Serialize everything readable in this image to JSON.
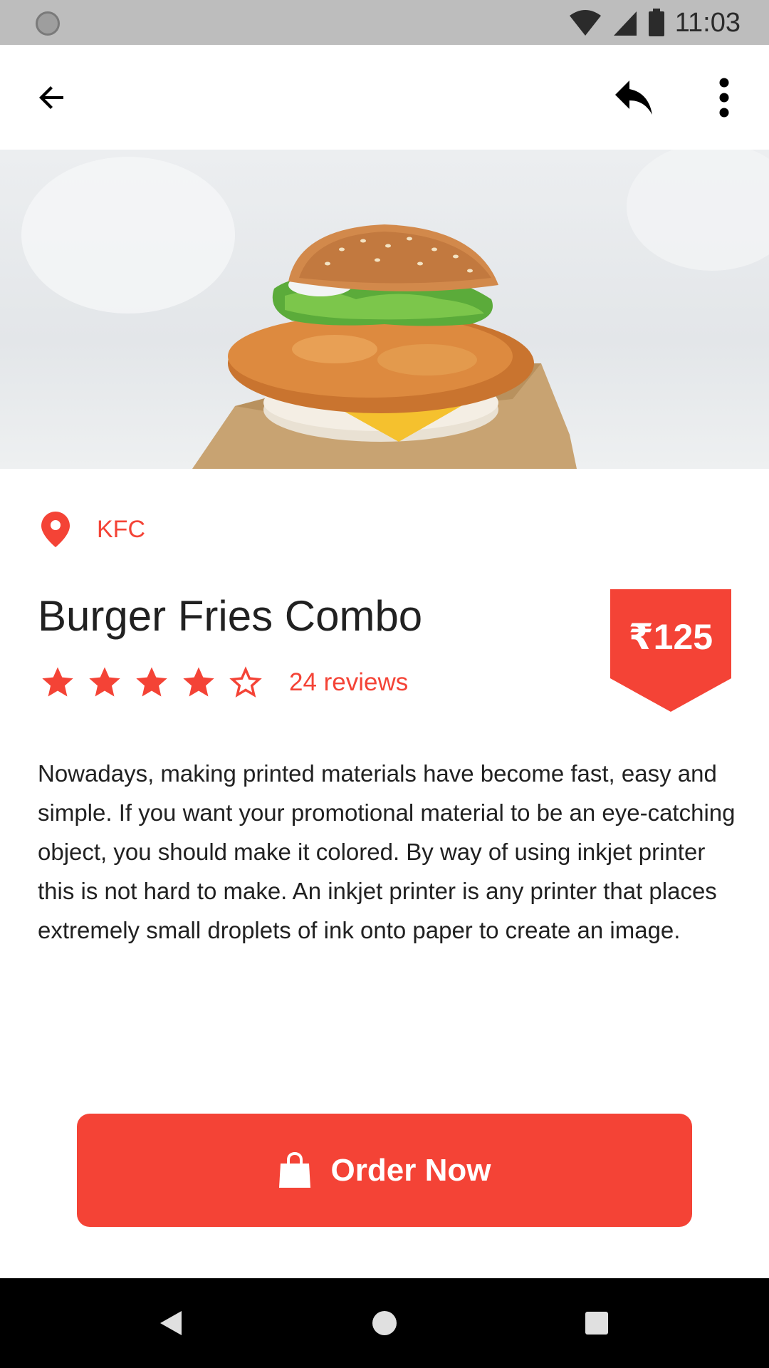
{
  "status_bar": {
    "time": "11:03",
    "icons": [
      "notification-dot-icon",
      "wifi-icon",
      "signal-icon",
      "battery-icon"
    ]
  },
  "app_bar": {
    "icons": [
      "back-arrow-icon",
      "share-reply-icon",
      "more-vert-icon"
    ]
  },
  "hero": {
    "icon": "burger-image"
  },
  "location": {
    "icon": "location-pin-icon",
    "label": "KFC"
  },
  "product": {
    "title": "Burger Fries Combo",
    "price": "₹125",
    "rating": 4,
    "rating_max": 5,
    "reviews": "24 reviews",
    "description": "Nowadays, making printed materials have become fast, easy and simple. If you want your promotional material to be an eye-catching object, you should make it colored. By way of using inkjet printer this is not hard to make. An inkjet printer is any printer that places extremely small droplets of ink onto paper to create an image."
  },
  "order_button": {
    "label": "Order Now",
    "icon": "shopping-bag-icon"
  },
  "nav_bar": {
    "icons": [
      "nav-back-icon",
      "nav-home-icon",
      "nav-recents-icon"
    ]
  },
  "colors": {
    "accent": "#f44336",
    "text": "#212121",
    "status_bar": "#bdbdbd"
  }
}
